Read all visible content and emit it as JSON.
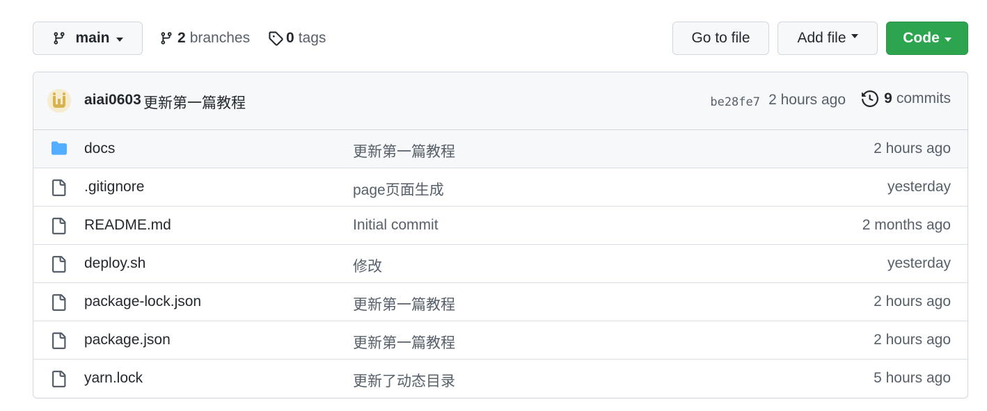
{
  "toolbar": {
    "branch": "main",
    "branches_count": "2",
    "branches_label": "branches",
    "tags_count": "0",
    "tags_label": "tags",
    "go_to_file": "Go to file",
    "add_file": "Add file",
    "code": "Code"
  },
  "commit": {
    "author": "aiai0603",
    "message": "更新第一篇教程",
    "sha": "be28fe7",
    "time": "2 hours ago",
    "commits_count": "9",
    "commits_label": "commits"
  },
  "files": [
    {
      "name": "docs",
      "type": "folder",
      "message": "更新第一篇教程",
      "time": "2 hours ago"
    },
    {
      "name": ".gitignore",
      "type": "file",
      "message": "page页面生成",
      "time": "yesterday"
    },
    {
      "name": "README.md",
      "type": "file",
      "message": "Initial commit",
      "time": "2 months ago"
    },
    {
      "name": "deploy.sh",
      "type": "file",
      "message": "修改",
      "time": "yesterday"
    },
    {
      "name": "package-lock.json",
      "type": "file",
      "message": "更新第一篇教程",
      "time": "2 hours ago"
    },
    {
      "name": "package.json",
      "type": "file",
      "message": "更新第一篇教程",
      "time": "2 hours ago"
    },
    {
      "name": "yarn.lock",
      "type": "file",
      "message": "更新了动态目录",
      "time": "5 hours ago"
    }
  ],
  "colors": {
    "accent_green": "#2da44e",
    "folder_blue": "#54aeff",
    "muted_text": "#57606a"
  }
}
